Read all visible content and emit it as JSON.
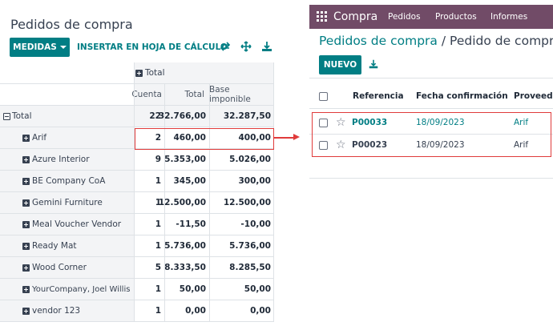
{
  "left": {
    "title": "Pedidos de compra",
    "measures_button": "MEDIDAS",
    "spreadsheet_link": "INSERTAR EN HOJA DE CÁLCULO",
    "pivot": {
      "column_group": "Total",
      "measures": [
        "Cuenta",
        "Total",
        "Base imponible"
      ],
      "total_row": {
        "label": "Total",
        "count": "22",
        "total": "32.766,00",
        "base": "32.287,50"
      },
      "rows": [
        {
          "label": "Arif",
          "count": "2",
          "total": "460,00",
          "base": "400,00"
        },
        {
          "label": "Azure Interior",
          "count": "9",
          "total": "5.353,00",
          "base": "5.026,00"
        },
        {
          "label": "BE Company CoA",
          "count": "1",
          "total": "345,00",
          "base": "300,00"
        },
        {
          "label": "Gemini Furniture",
          "count": "1",
          "total": "12.500,00",
          "base": "12.500,00"
        },
        {
          "label": "Meal Voucher Vendor",
          "count": "1",
          "total": "-11,50",
          "base": "-10,00"
        },
        {
          "label": "Ready Mat",
          "count": "1",
          "total": "5.736,00",
          "base": "5.736,00"
        },
        {
          "label": "Wood Corner",
          "count": "5",
          "total": "8.333,50",
          "base": "8.285,50"
        },
        {
          "label": "YourCompany, Joel Willis",
          "count": "1",
          "total": "50,00",
          "base": "50,00"
        },
        {
          "label": "vendor 123",
          "count": "1",
          "total": "0,00",
          "base": "0,00"
        }
      ]
    }
  },
  "right": {
    "app_name": "Compra",
    "nav": [
      "Pedidos",
      "Productos",
      "Informes"
    ],
    "breadcrumb_parent": "Pedidos de compra",
    "breadcrumb_sep": "/",
    "breadcrumb_current": "Pedido de compra",
    "new_button": "NUEVO",
    "columns": [
      "Referencia",
      "Fecha confirmación",
      "Proveedor"
    ],
    "rows": [
      {
        "ref": "P00033",
        "date": "18/09/2023",
        "vendor": "Arif"
      },
      {
        "ref": "P00023",
        "date": "18/09/2023",
        "vendor": "Arif"
      }
    ]
  },
  "colors": {
    "accent": "#017e84",
    "navbar": "#714b67",
    "highlight": "#e03b3b"
  }
}
